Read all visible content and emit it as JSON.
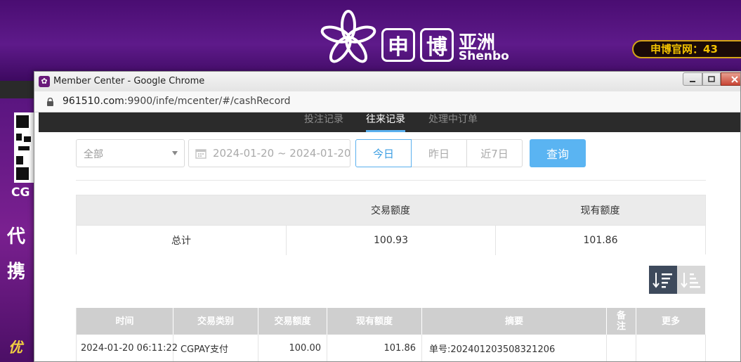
{
  "background_site": {
    "logo_box_1": "申",
    "logo_box_2": "博",
    "logo_cn": "亚洲",
    "logo_en": "Shenbo",
    "official_site": "申博官网：43",
    "left_cg": "CG",
    "left_char_1": "代",
    "left_char_2": "携",
    "left_char_3": "优"
  },
  "window": {
    "title": "Member Center - Google Chrome",
    "url_host": "961510.com",
    "url_path": ":9900/infe/mcenter/#/cashRecord"
  },
  "tabs": [
    {
      "label": "投注记录",
      "active": false
    },
    {
      "label": "往来记录",
      "active": true
    },
    {
      "label": "处理中订单",
      "active": false
    }
  ],
  "filters": {
    "type_select": "全部",
    "date_range": "2024-01-20 ~ 2024-01-20",
    "today": "今日",
    "yesterday": "昨日",
    "last_7_days": "近7日",
    "query": "查询"
  },
  "summary": {
    "header_amount": "交易额度",
    "header_balance": "现有额度",
    "total_label": "总计",
    "total_amount": "100.93",
    "total_balance": "101.86"
  },
  "records": {
    "headers": {
      "time": "时间",
      "type": "交易类别",
      "amount": "交易额度",
      "balance": "现有额度",
      "summary": "摘要",
      "remark": "备注",
      "more": "更多"
    },
    "rows": [
      {
        "time": "2024-01-20 06:11:22",
        "type": "CGPAY支付",
        "amount": "100.00",
        "balance": "101.86",
        "summary": "单号:202401203508321206",
        "remark": "",
        "more": ""
      }
    ]
  },
  "colors": {
    "accent": "#5ab4f2",
    "tab_bar": "#2b2b2b",
    "table_header": "#cfcfcf"
  }
}
